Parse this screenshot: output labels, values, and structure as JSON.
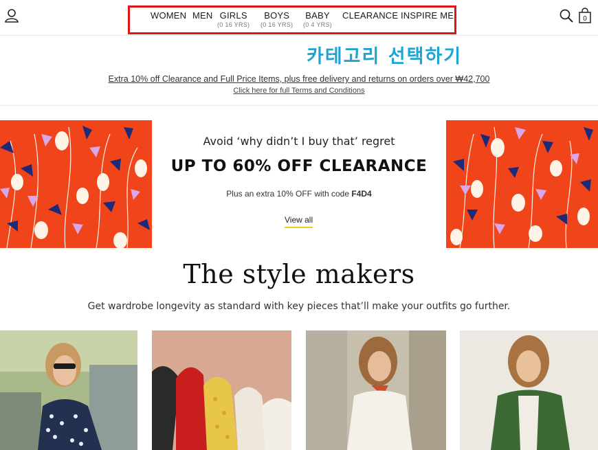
{
  "header": {
    "nav": [
      {
        "label": "WOMEN",
        "sub": ""
      },
      {
        "label": "MEN",
        "sub": ""
      },
      {
        "label": "GIRLS",
        "sub": "(0  16 YRS)"
      },
      {
        "label": "BOYS",
        "sub": "(0  16 YRS)"
      },
      {
        "label": "BABY",
        "sub": "(0  4 YRS)"
      },
      {
        "label": "CLEARANCE",
        "sub": ""
      },
      {
        "label": "INSPIRE ME",
        "sub": ""
      }
    ],
    "bag_count": "0",
    "icons": {
      "account": "user-icon",
      "search": "search-icon",
      "bag": "shopping-bag-icon"
    }
  },
  "annotation": "카테고리 선택하기",
  "promo": {
    "line1": "Extra 10% off Clearance and Full Price Items, plus free delivery and returns on orders over ₩42,700",
    "line2": "Click here for full Terms and Conditions"
  },
  "banner": {
    "kicker": "Avoid ‘why didn’t I buy that’ regret",
    "headline": "UP TO 60% OFF CLEARANCE",
    "sub_prefix": "Plus an extra 10% OFF with code ",
    "code": "F4D4",
    "cta": "View all",
    "accent_color": "#f0441a",
    "underline_color": "#f2cb17"
  },
  "section": {
    "title": "The style makers",
    "subtitle": "Get wardrobe longevity as standard with key pieces that’ll make your outfits go further."
  },
  "colors": {
    "nav_highlight": "#e01414",
    "annotation": "#1fa3d1"
  }
}
